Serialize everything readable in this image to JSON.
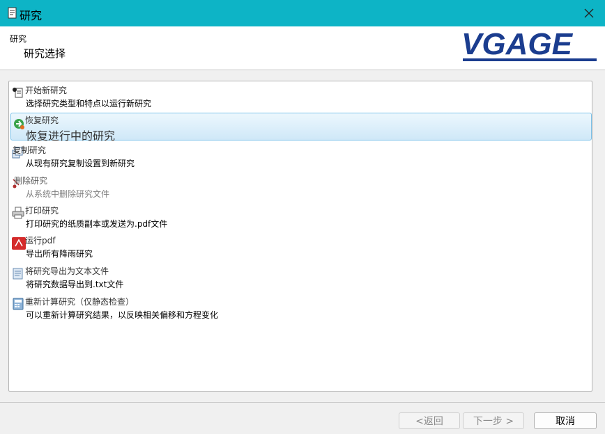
{
  "window": {
    "title": "研究",
    "close_icon": "close-icon"
  },
  "header": {
    "category": "研究",
    "subtitle": "研究选择",
    "logo_text": "VGAGE",
    "logo_color": "#1b3d8f"
  },
  "items": [
    {
      "title": "开始新研究",
      "desc": "选择研究类型和特点以运行新研究",
      "icon": "new-document-icon"
    },
    {
      "title": "恢复研究",
      "desc": "恢复进行中的研究",
      "icon": "resume-icon",
      "selected": true
    },
    {
      "title": "复制研究",
      "desc": "从现有研究复制设置到新研究",
      "icon": "copy-icon"
    },
    {
      "title": "删除研究",
      "desc": "从系统中删除研究文件",
      "icon": "delete-icon",
      "disabled": true
    },
    {
      "title": "打印研究",
      "desc": "打印研究的纸质副本或发送为.pdf文件",
      "icon": "printer-icon"
    },
    {
      "title": "运行pdf",
      "desc": "导出所有降雨研究",
      "icon": "pdf-icon"
    },
    {
      "title": "将研究导出为文本文件",
      "desc": "将研究数据导出到.txt文件",
      "icon": "export-text-icon"
    },
    {
      "title": "重新计算研究（仅静态检查）",
      "desc": "可以重新计算研究结果，以反映相关偏移和方程变化",
      "icon": "calculator-icon"
    }
  ],
  "buttons": {
    "back": "<返回",
    "next": "下一步 >",
    "cancel": "取消"
  },
  "colors": {
    "titlebar": "#0db4c6",
    "selection": "#cfe8f8"
  }
}
